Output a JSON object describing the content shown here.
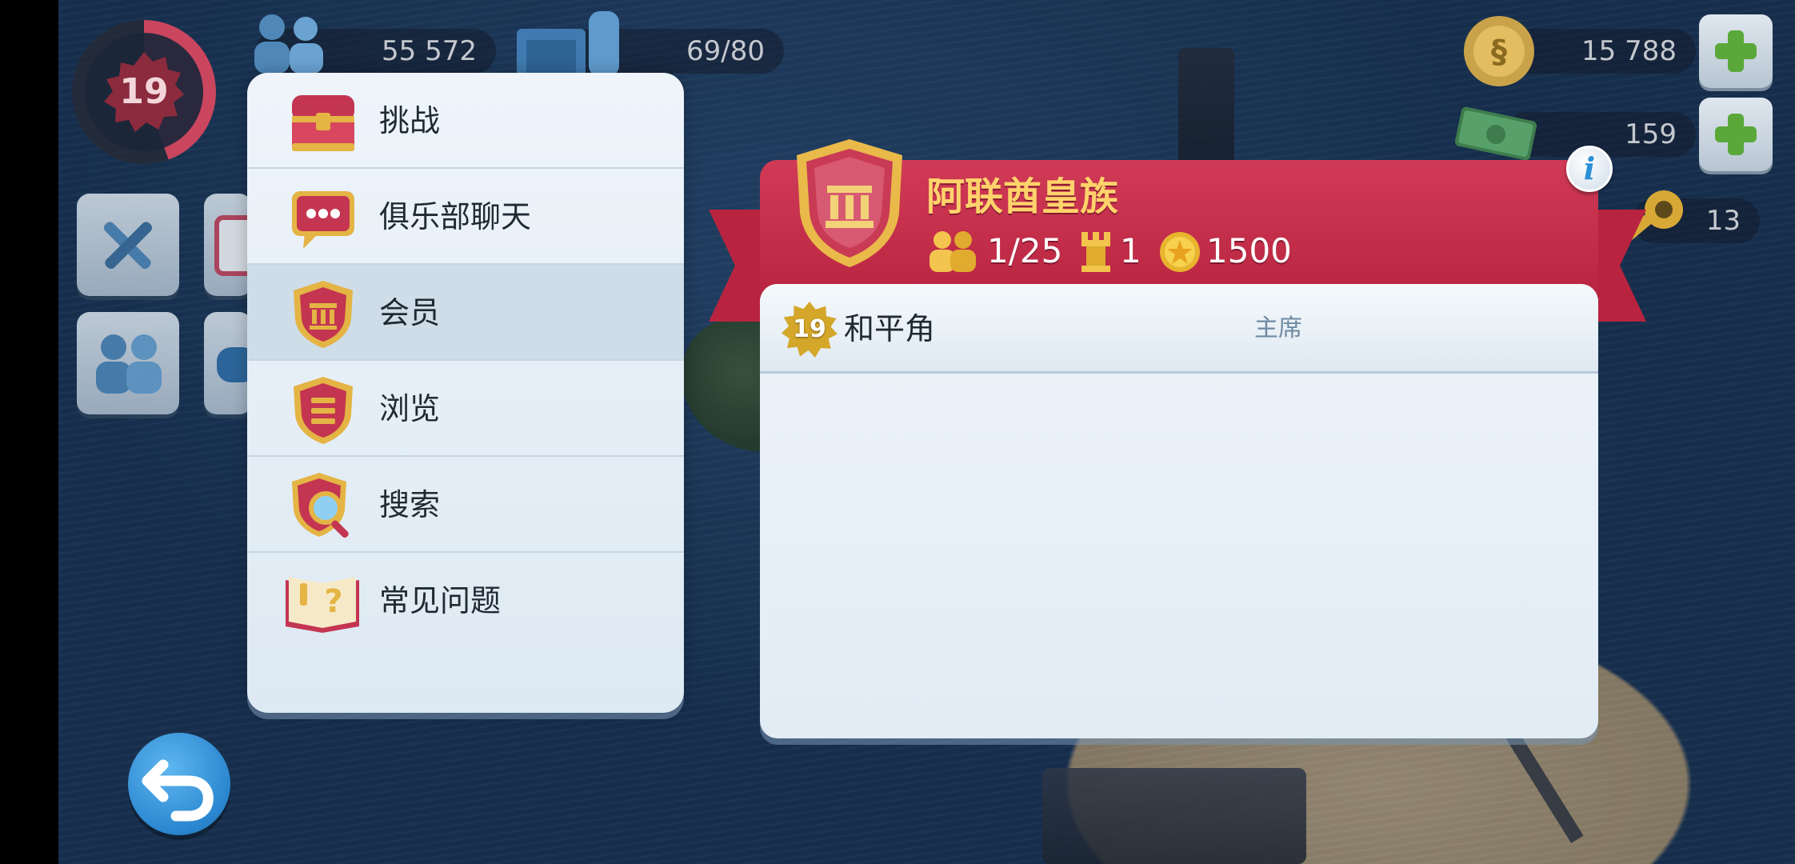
{
  "hud": {
    "level": "19",
    "population": "55 572",
    "storage": "69/80",
    "simoleons": "15 788",
    "simcash": "159",
    "keys": "13"
  },
  "menu": {
    "items": [
      {
        "label": "挑战",
        "icon": "treasure-chest-icon"
      },
      {
        "label": "俱乐部聊天",
        "icon": "chat-bubble-icon"
      },
      {
        "label": "会员",
        "icon": "club-shield-icon"
      },
      {
        "label": "浏览",
        "icon": "list-shield-icon"
      },
      {
        "label": "搜索",
        "icon": "magnifier-shield-icon"
      },
      {
        "label": "常见问题",
        "icon": "faq-book-icon"
      }
    ],
    "active_index": 2
  },
  "club": {
    "name": "阿联酋皇族",
    "members": "1/25",
    "wars": "1",
    "points": "1500",
    "member_list": [
      {
        "level": "19",
        "name": "和平角",
        "role": "主席"
      }
    ]
  },
  "colors": {
    "banner_red": "#b8243f",
    "gold": "#ffd36b",
    "panel": "#eef4fa",
    "accent_blue": "#2a86cf"
  }
}
